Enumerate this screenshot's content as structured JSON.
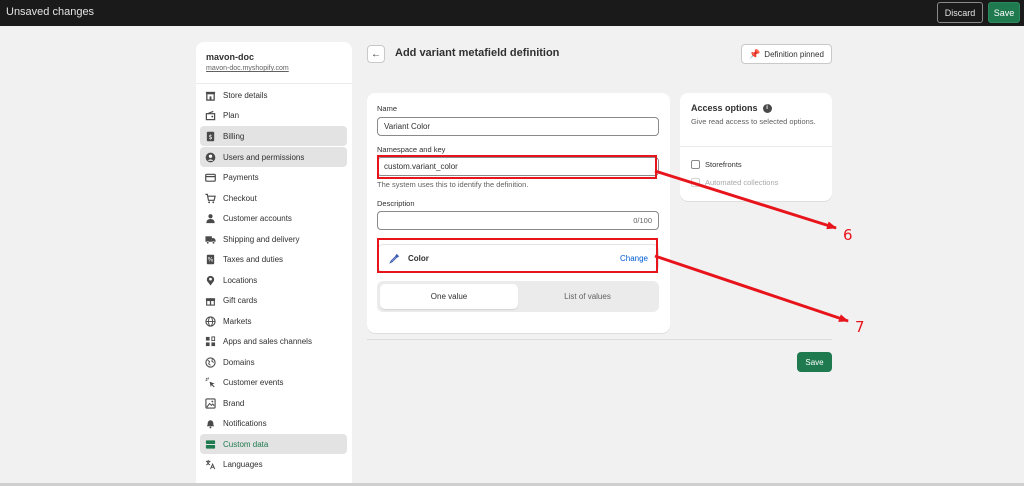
{
  "topbar": {
    "title": "Unsaved changes",
    "discard_label": "Discard",
    "save_label": "Save"
  },
  "store": {
    "name": "mavon-doc",
    "url": "mavon-doc.myshopify.com"
  },
  "sidebar": {
    "items": [
      {
        "label": "Store details",
        "icon": "store-icon"
      },
      {
        "label": "Plan",
        "icon": "plan-icon"
      },
      {
        "label": "Billing",
        "icon": "billing-icon"
      },
      {
        "label": "Users and permissions",
        "icon": "user-circle-icon"
      },
      {
        "label": "Payments",
        "icon": "credit-card-icon"
      },
      {
        "label": "Checkout",
        "icon": "cart-icon"
      },
      {
        "label": "Customer accounts",
        "icon": "person-icon"
      },
      {
        "label": "Shipping and delivery",
        "icon": "truck-icon"
      },
      {
        "label": "Taxes and duties",
        "icon": "tax-icon"
      },
      {
        "label": "Locations",
        "icon": "location-pin-icon"
      },
      {
        "label": "Gift cards",
        "icon": "gift-icon"
      },
      {
        "label": "Markets",
        "icon": "globe-icon"
      },
      {
        "label": "Apps and sales channels",
        "icon": "apps-icon"
      },
      {
        "label": "Domains",
        "icon": "domain-globe-icon"
      },
      {
        "label": "Customer events",
        "icon": "cursor-icon"
      },
      {
        "label": "Brand",
        "icon": "brand-icon"
      },
      {
        "label": "Notifications",
        "icon": "bell-icon"
      },
      {
        "label": "Custom data",
        "icon": "custom-data-icon"
      },
      {
        "label": "Languages",
        "icon": "translate-icon"
      }
    ]
  },
  "header": {
    "title": "Add variant metafield definition",
    "pinned_label": "Definition pinned"
  },
  "form": {
    "name_label": "Name",
    "name_value": "Variant Color",
    "namespace_label": "Namespace and key",
    "namespace_value": "custom.variant_color",
    "namespace_help": "The system uses this to identify the definition.",
    "description_label": "Description",
    "description_counter": "0/100",
    "type_name": "Color",
    "change_label": "Change",
    "one_value_label": "One value",
    "list_label": "List of values"
  },
  "access": {
    "title": "Access options",
    "description": "Give read access to selected options.",
    "storefronts_label": "Storefronts",
    "automated_label": "Automated collections"
  },
  "footer": {
    "save_label": "Save"
  },
  "annotations": {
    "label_6": "6",
    "label_7": "7",
    "color": "#e8141b"
  }
}
